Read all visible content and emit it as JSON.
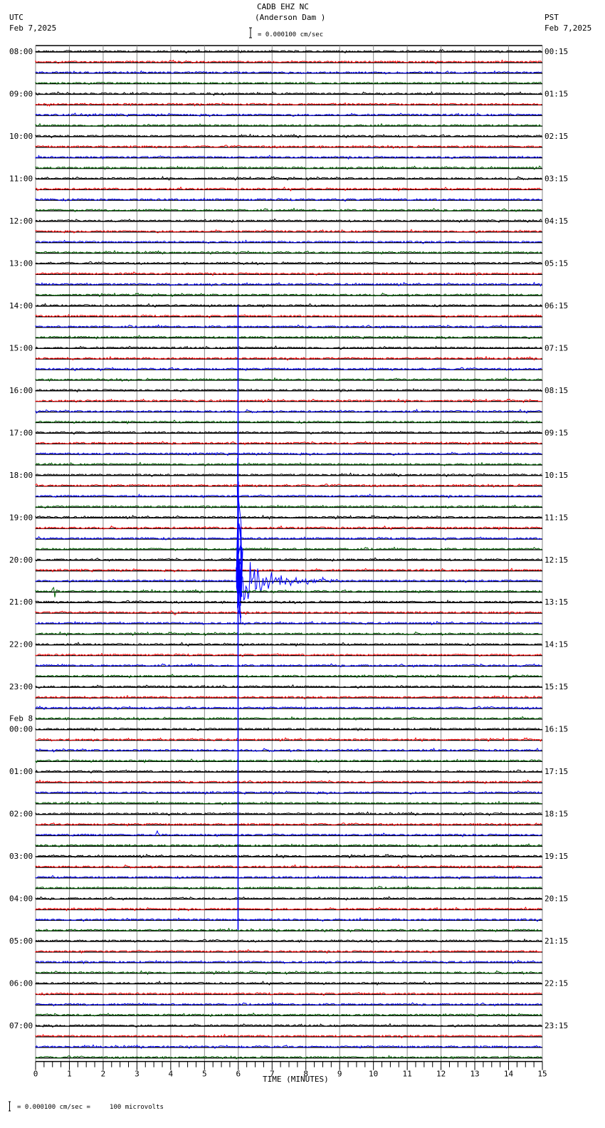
{
  "header": {
    "station": "CADB EHZ NC",
    "location": "(Anderson Dam )",
    "left_tz": "UTC",
    "left_date": "Feb 7,2025",
    "right_tz": "PST",
    "right_date": "Feb 7,2025",
    "scale_text": "= 0.000100 cm/sec"
  },
  "footer": {
    "scale_text": "= 0.000100 cm/sec =     100 microvolts"
  },
  "chart_data": {
    "type": "line",
    "title": "CADB EHZ NC (Anderson Dam )",
    "xlabel": "TIME (MINUTES)",
    "xlim": [
      0,
      15
    ],
    "x_ticks": [
      "0",
      "1",
      "2",
      "3",
      "4",
      "5",
      "6",
      "7",
      "8",
      "9",
      "10",
      "11",
      "12",
      "13",
      "14",
      "15"
    ],
    "minor_ticks_per_minute": 4,
    "trace_minutes": 15,
    "trace_colors": [
      "#000000",
      "#ff0000",
      "#0000ff",
      "#006400"
    ],
    "left_labels": [
      "08:00",
      "09:00",
      "10:00",
      "11:00",
      "12:00",
      "13:00",
      "14:00",
      "15:00",
      "16:00",
      "17:00",
      "18:00",
      "19:00",
      "20:00",
      "21:00",
      "22:00",
      "23:00",
      "00:00",
      "01:00",
      "02:00",
      "03:00",
      "04:00",
      "05:00",
      "06:00",
      "07:00"
    ],
    "date_change_label": "Feb 8",
    "right_labels": [
      "00:15",
      "01:15",
      "02:15",
      "03:15",
      "04:15",
      "05:15",
      "06:15",
      "07:15",
      "08:15",
      "09:15",
      "10:15",
      "11:15",
      "12:15",
      "13:15",
      "14:15",
      "15:15",
      "16:15",
      "17:15",
      "18:15",
      "19:15",
      "20:15",
      "21:15",
      "22:15",
      "23:15"
    ],
    "trace_count": 96,
    "events": [
      {
        "trace_index": 50,
        "minute": 5.95,
        "coda_minutes": 3.2,
        "amplitude_traces": 28,
        "type": "large-earthquake"
      },
      {
        "trace_index": 51,
        "minute": 0.5,
        "coda_minutes": 0.3,
        "amplitude_traces": 1.3,
        "type": "local-event"
      },
      {
        "trace_index": 53,
        "minute": 4.1,
        "coda_minutes": 0.3,
        "amplitude_traces": 0.4,
        "type": "local-event"
      },
      {
        "trace_index": 74,
        "minute": 3.6,
        "coda_minutes": 0.2,
        "amplitude_traces": 0.6,
        "type": "local-event"
      },
      {
        "trace_index": 50,
        "minute": 8.5,
        "coda_minutes": 0.1,
        "amplitude_traces": 0.4,
        "type": "aftershock"
      },
      {
        "trace_index": 50,
        "minute": 10.1,
        "coda_minutes": 0.1,
        "amplitude_traces": 0.3,
        "type": "aftershock"
      },
      {
        "trace_index": 59,
        "minute": 14.0,
        "coda_minutes": 1.0,
        "amplitude_traces": 0.3,
        "type": "noise-burst"
      }
    ]
  }
}
